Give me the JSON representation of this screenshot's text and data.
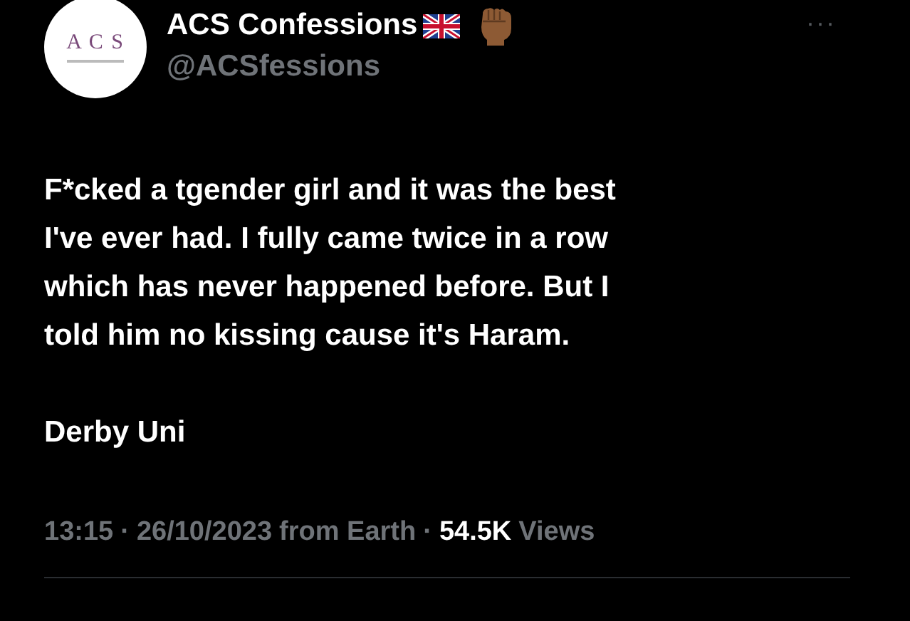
{
  "author": {
    "avatar_text": "A C S",
    "name": "ACS Confessions",
    "handle": "@ACSfessions"
  },
  "more_button": "···",
  "body": {
    "lines": [
      "F*cked a tgender girl and it was the best",
      "I've ever had. I fully came twice in a row",
      "which has never happened before. But I",
      "told him no kissing cause it's Haram."
    ],
    "signature": "Derby Uni"
  },
  "meta": {
    "time": "13:15",
    "date": "26/10/2023",
    "source": "from Earth",
    "separator": "·",
    "views_count": "54.5K",
    "views_label": "Views"
  }
}
